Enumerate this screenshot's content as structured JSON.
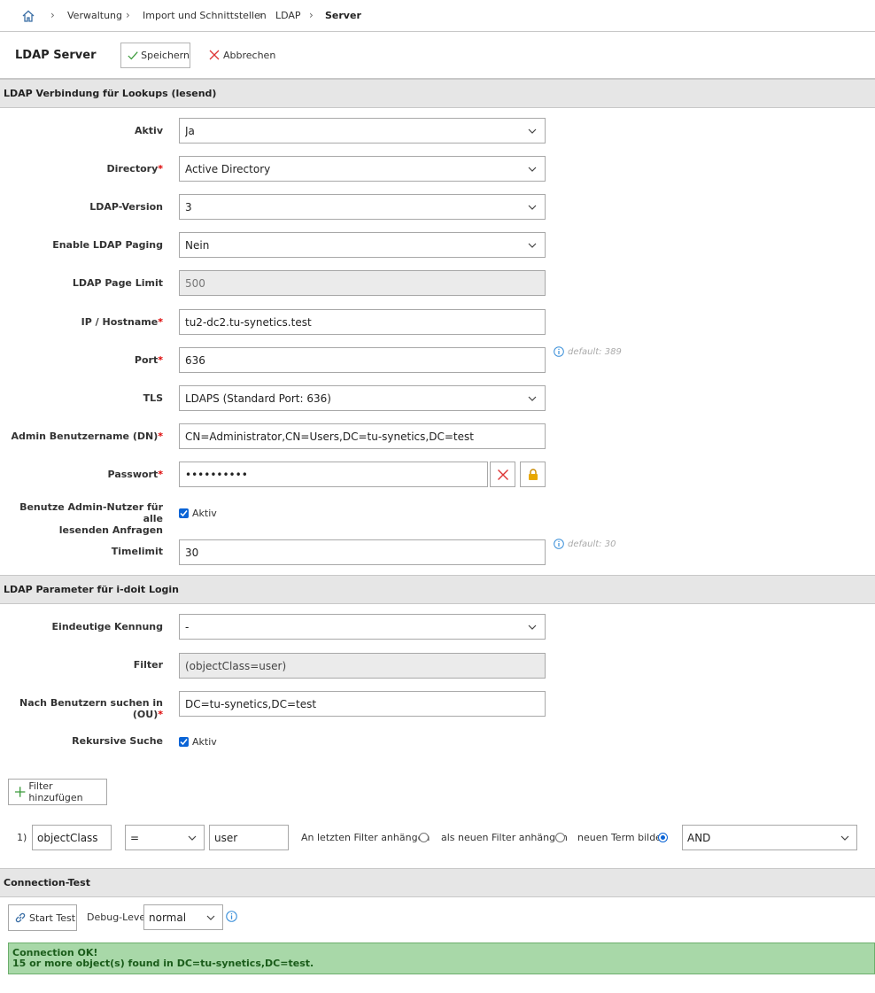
{
  "breadcrumb": {
    "items": [
      "Verwaltung",
      "Import und Schnittstellen",
      "LDAP",
      "Server"
    ]
  },
  "header": {
    "title": "LDAP Server",
    "save_label": "Speichern",
    "cancel_label": "Abbrechen"
  },
  "sections": {
    "lookup": "LDAP Verbindung für Lookups (lesend)",
    "login": "LDAP Parameter für i-doit Login",
    "test": "Connection-Test"
  },
  "lookup_fields": {
    "aktiv": {
      "label": "Aktiv",
      "value": "Ja"
    },
    "directory": {
      "label": "Directory",
      "value": "Active Directory"
    },
    "version": {
      "label": "LDAP-Version",
      "value": "3"
    },
    "paging": {
      "label": "Enable LDAP Paging",
      "value": "Nein"
    },
    "page_limit": {
      "label": "LDAP Page Limit",
      "value": "500"
    },
    "host": {
      "label": "IP / Hostname",
      "value": "tu2-dc2.tu-synetics.test"
    },
    "port": {
      "label": "Port",
      "value": "636",
      "hint": "default: 389"
    },
    "tls": {
      "label": "TLS",
      "value": "LDAPS (Standard Port: 636)"
    },
    "admin_dn": {
      "label": "Admin Benutzername (DN)",
      "value": "CN=Administrator,CN=Users,DC=tu-synetics,DC=test"
    },
    "password": {
      "label": "Passwort",
      "value": "••••••••••"
    },
    "use_admin": {
      "label_line1": "Benutze Admin-Nutzer für alle",
      "label_line2": "lesenden Anfragen",
      "checkbox_label": "Aktiv"
    },
    "timelimit": {
      "label": "Timelimit",
      "value": "30",
      "hint": "default: 30"
    }
  },
  "login_fields": {
    "kennung": {
      "label": "Eindeutige Kennung",
      "value": "-"
    },
    "filter": {
      "label": "Filter",
      "value": "(objectClass=user)"
    },
    "ou": {
      "label": "Nach Benutzern suchen in (OU)",
      "value": "DC=tu-synetics,DC=test"
    },
    "recursive": {
      "label": "Rekursive Suche",
      "checkbox_label": "Aktiv"
    }
  },
  "filter_builder": {
    "add_label": "Filter hinzufügen",
    "row_number": "1)",
    "attribute": "objectClass",
    "operator": "=",
    "value": "user",
    "opt_append_last": "An letzten Filter anhängen",
    "opt_append_new": "als neuen Filter anhängen",
    "opt_new_term": "neuen Term bilden",
    "logic": "AND"
  },
  "connection_test": {
    "start_label": "Start Test",
    "debug_label": "Debug-Level",
    "debug_value": "normal",
    "result_line1": "Connection OK!",
    "result_line2": "15 or more object(s) found in DC=tu-synetics,DC=test."
  },
  "colors": {
    "section_bg": "#e6e6e6",
    "required": "#dd0000",
    "success_bg": "#a8d8a8",
    "accent": "#0a64d6"
  }
}
